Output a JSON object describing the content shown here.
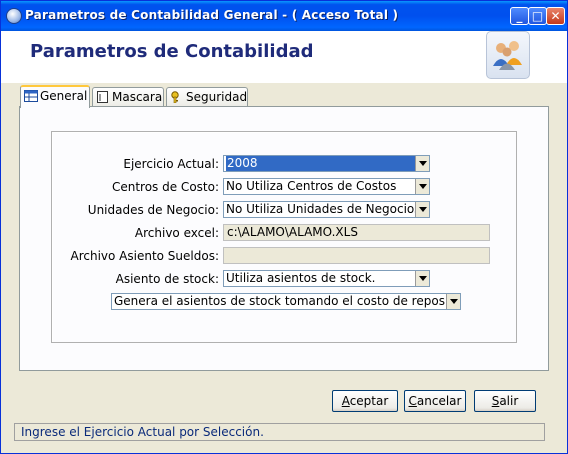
{
  "window": {
    "title": "Parametros de Contabilidad General  - ( Acceso Total )",
    "controls": {
      "minimize": "_",
      "maximize": "□",
      "close": "✕"
    },
    "icon": "app-globe-icon"
  },
  "header": {
    "title": "Parametros de Contabilidad",
    "logo_icon": "users-group-icon"
  },
  "tabs": [
    {
      "label": "General",
      "icon": "table-icon",
      "active": true
    },
    {
      "label": "Mascara",
      "icon": "document-icon",
      "active": false
    },
    {
      "label": "Seguridad",
      "icon": "key-icon",
      "active": false
    }
  ],
  "form": {
    "ejercicio": {
      "label": "Ejercicio Actual:",
      "value": "2008"
    },
    "centros": {
      "label": "Centros de Costo:",
      "value": "No Utiliza Centros de Costos"
    },
    "unidades": {
      "label": "Unidades de Negocio:",
      "value": "No Utiliza Unidades de Negocios."
    },
    "excel": {
      "label": "Archivo excel:",
      "value": "c:\\ALAMO\\ALAMO.XLS"
    },
    "sueldos": {
      "label": "Archivo Asiento Sueldos:",
      "value": ""
    },
    "stock": {
      "label": "Asiento de stock:",
      "value": "Utiliza asientos de stock."
    },
    "costo": {
      "value": "Genera el asientos de stock tomando el costo de reposición"
    }
  },
  "buttons": {
    "aceptar": {
      "label": "Aceptar",
      "mnemonic": "A",
      "rest": "ceptar"
    },
    "cancelar": {
      "label": "Cancelar",
      "mnemonic": "C",
      "rest": "ancelar"
    },
    "salir": {
      "label": "Salir",
      "mnemonic": "S",
      "rest": "alir"
    }
  },
  "status": {
    "text": "Ingrese el Ejercicio Actual por Selección."
  },
  "colors": {
    "title_bar": "#0055ea",
    "heading": "#1f2b7a",
    "selection": "#316ac5"
  }
}
